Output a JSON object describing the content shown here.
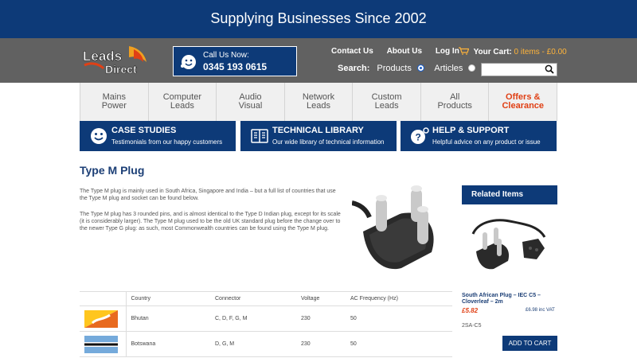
{
  "topbar": {
    "tagline": "Supplying Businesses Since 2002"
  },
  "brand": {
    "primary": "#0d3a78",
    "accent": "#e04015",
    "header_bg": "#616161"
  },
  "header": {
    "logo_text": "Leads Direct",
    "call_label": "Call Us Now:",
    "call_number": "0345 193 0615",
    "links": [
      "Contact Us",
      "About Us",
      "Log In"
    ],
    "cart_label": "Your Cart:",
    "cart_value": "0 items - £0.00",
    "search_label": "Search:",
    "search_options": [
      "Products",
      "Articles"
    ],
    "search_selected": "Products"
  },
  "nav": [
    "Mains\nPower",
    "Computer\nLeads",
    "Audio\nVisual",
    "Network\nLeads",
    "Custom\nLeads",
    "All\nProducts",
    "Offers &\nClearance"
  ],
  "promos": [
    {
      "title": "CASE STUDIES",
      "subtitle": "Testimonials from our happy customers",
      "icon": "smiley-icon"
    },
    {
      "title": "TECHNICAL LIBRARY",
      "subtitle": "Our wide library of technical information",
      "icon": "library-icon"
    },
    {
      "title": "HELP & SUPPORT",
      "subtitle": "Helpful advice on any product or issue",
      "icon": "help-icon"
    }
  ],
  "page": {
    "title": "Type M Plug",
    "paragraph1": "The Type M plug is mainly used in South Africa, Singapore and India – but a full list of countries that use the Type M plug and socket can be found below.",
    "paragraph2": "The Type M plug has 3 rounded pins, and is almost identical to the Type D Indian plug, except for its scale (it is considerably larger). The Type M plug used to be the old UK standard plug before the change over to the newer Type G plug: as such, most Commonwealth countries can be found using the Type M plug."
  },
  "table": {
    "headers": [
      "",
      "Country",
      "Connector",
      "Voltage",
      "AC Frequency (Hz)"
    ],
    "rows": [
      {
        "country": "Bhutan",
        "connector": "C, D, F, G, M",
        "voltage": "230",
        "frequency": "50"
      },
      {
        "country": "Botswana",
        "connector": "D, G, M",
        "voltage": "230",
        "frequency": "50"
      }
    ]
  },
  "sidebar": {
    "heading": "Related Items",
    "item_name": "South African Plug – IEC C5 – Cloverleaf – 2m",
    "price": "£5.82",
    "price_vat": "£6.98 inc VAT",
    "sku": "2SA-C5",
    "add_to_cart": "ADD TO CART"
  }
}
